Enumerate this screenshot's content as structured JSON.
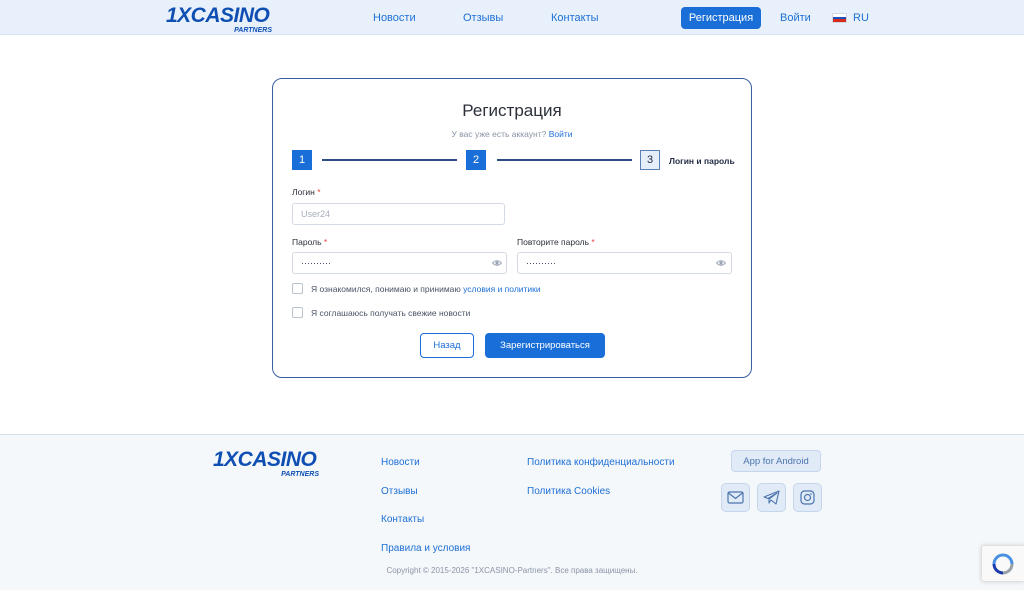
{
  "brand": {
    "logo_main": "1XCASINO",
    "logo_sub": "PARTNERS",
    "color": "#0f4fb3"
  },
  "header": {
    "nav": [
      "Новости",
      "Отзывы",
      "Контакты"
    ],
    "register_label": "Регистрация",
    "login_label": "Войти",
    "language": "RU",
    "flag_icon": "russia-flag-icon"
  },
  "form": {
    "title": "Регистрация",
    "have_account_text": "У вас уже есть аккаунт?",
    "login_link": "Войти",
    "steps": [
      {
        "number": "1",
        "state": "done"
      },
      {
        "number": "2",
        "state": "done"
      },
      {
        "number": "3",
        "state": "current",
        "label": "Логин и пароль"
      }
    ],
    "login_label": "Логин",
    "login_placeholder": "User24",
    "login_value": "",
    "password_label": "Пароль",
    "password_value": "··········",
    "repeat_password_label": "Повторите пароль",
    "repeat_password_value": "··········",
    "required_mark": "*",
    "terms_text": "Я ознакомился, понимаю и принимаю",
    "terms_link": "условия и политики",
    "news_text": "Я соглашаюсь получать свежие новости",
    "back_label": "Назад",
    "submit_label": "Зарегистрироваться",
    "eye_icon": "eye-icon"
  },
  "footer": {
    "links_col1": [
      "Новости",
      "Отзывы",
      "Контакты",
      "Правила и условия"
    ],
    "links_col2": [
      "Политика конфиденциальности",
      "Политика Cookies"
    ],
    "android_label": "App for Android",
    "social_icons": [
      "mail-icon",
      "telegram-icon",
      "instagram-icon"
    ],
    "copyright": "Copyright © 2015-2026 \"1XCASINO-Partners\". Все права защищены."
  },
  "colors": {
    "accent": "#1a6ed8",
    "header_bg": "#e8f1fb",
    "footer_bg": "#f5f8fb",
    "card_border": "#3a5f9e",
    "required": "#e0433b"
  }
}
